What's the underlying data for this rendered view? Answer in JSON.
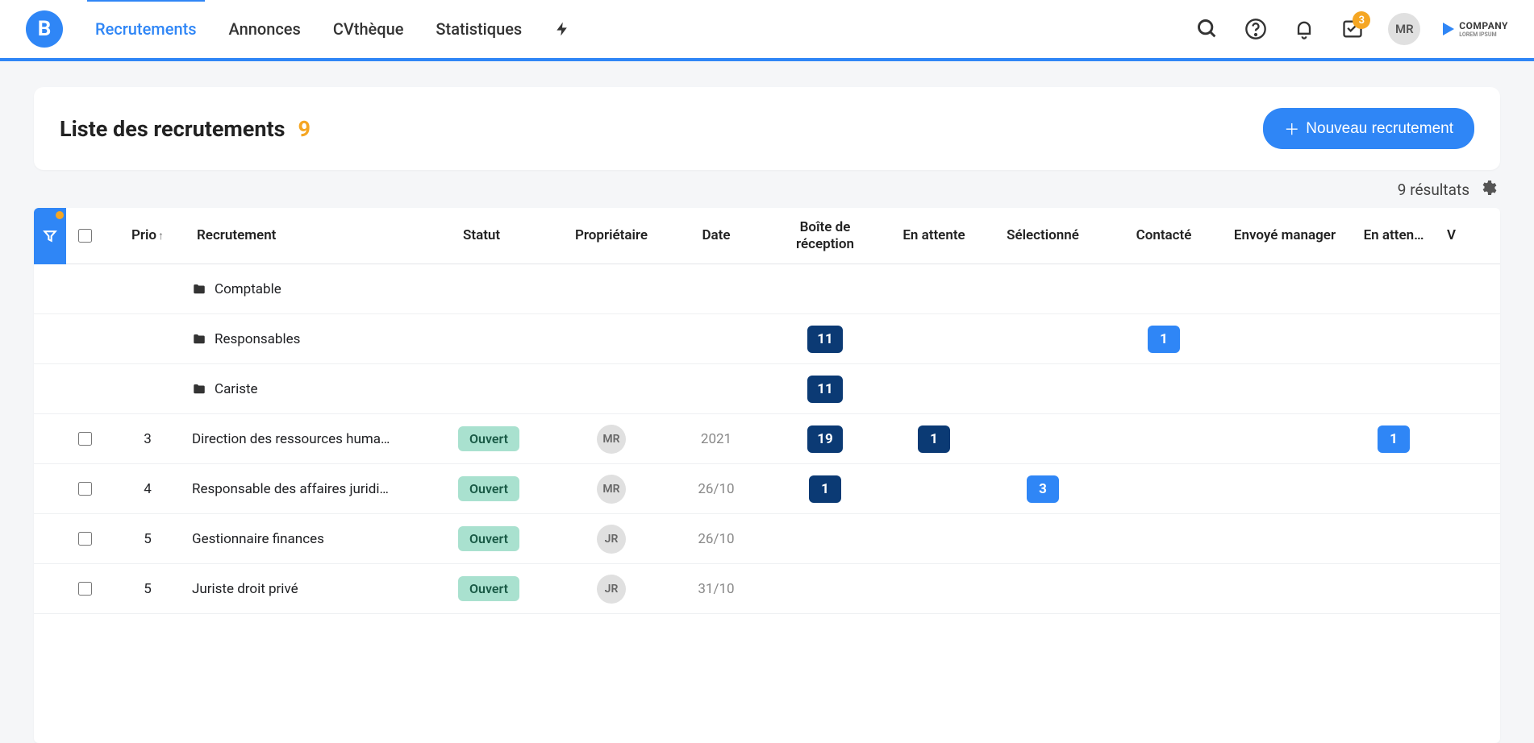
{
  "nav": {
    "items": [
      "Recrutements",
      "Annonces",
      "CVthèque",
      "Statistiques"
    ],
    "activeIndex": 0
  },
  "topbar": {
    "notifBadge": "3",
    "userInitials": "MR",
    "companyName": "COMPANY",
    "companyTagline": "LOREM IPSUM"
  },
  "page": {
    "title": "Liste des recrutements",
    "count": "9",
    "newButton": "Nouveau recrutement",
    "resultsText": "9 résultats"
  },
  "columns": {
    "prio": "Prio",
    "recrutement": "Recrutement",
    "statut": "Statut",
    "proprietaire": "Propriétaire",
    "date": "Date",
    "boite": "Boîte de réception",
    "attente1": "En attente",
    "selectionne": "Sélectionné",
    "contacte": "Contacté",
    "envoye": "Envoyé manager",
    "attente2": "En atten…",
    "v": "V"
  },
  "rows": [
    {
      "type": "folder",
      "name": "Comptable"
    },
    {
      "type": "folder",
      "name": "Responsables",
      "boite": "11",
      "boiteStyle": "dark",
      "contacte": "1",
      "contacteStyle": "light"
    },
    {
      "type": "folder",
      "name": "Cariste",
      "boite": "11",
      "boiteStyle": "dark"
    },
    {
      "type": "job",
      "prio": "3",
      "name": "Direction des ressources huma…",
      "statut": "Ouvert",
      "owner": "MR",
      "date": "2021",
      "boite": "19",
      "boiteStyle": "dark",
      "attente1": "1",
      "attente1Style": "dark",
      "attente2": "1",
      "attente2Style": "light"
    },
    {
      "type": "job",
      "prio": "4",
      "name": "Responsable des affaires juridi…",
      "statut": "Ouvert",
      "owner": "MR",
      "date": "26/10",
      "boite": "1",
      "boiteStyle": "dark",
      "selectionne": "3",
      "selectionneStyle": "light"
    },
    {
      "type": "job",
      "prio": "5",
      "name": "Gestionnaire finances",
      "statut": "Ouvert",
      "owner": "JR",
      "date": "26/10"
    },
    {
      "type": "job",
      "prio": "5",
      "name": "Juriste droit privé",
      "statut": "Ouvert",
      "owner": "JR",
      "date": "31/10"
    }
  ]
}
